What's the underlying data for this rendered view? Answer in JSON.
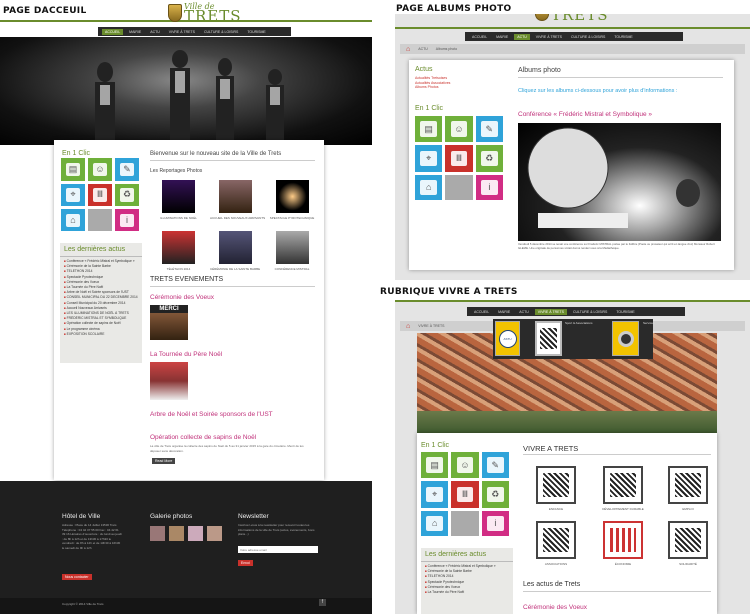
{
  "captions": {
    "home": "PAGE DACCEUIL",
    "albums": "PAGE ALBUMS PHOTO",
    "vivre": "RUBRIQUE VIVRE A TRETS"
  },
  "logo": {
    "line1": "Ville de",
    "line2": "TRETS"
  },
  "nav": [
    "ACCUEIL",
    "MAIRIE",
    "ACTU",
    "VIVRE À TRETS",
    "CULTURE & LOISIRS",
    "TOURISME"
  ],
  "home": {
    "en1clic": "En 1 Clic",
    "welcome": "Bienvenue sur le nouveau site de la Ville de Trets",
    "reportages": "Les Reportages Photos",
    "thumbs": [
      "ILLUMINATIONS DE NOËL",
      "ACCUEIL DES NOUVEAUX ARRIVANTS",
      "SPECTACLE PYROTECHNIQUE",
      "TÉLÉTHON 2014",
      "CÉRÉMONIE DE LA SAINTE BARBE",
      "CONFÉRENCE MISTRAL"
    ],
    "events": "TRETS EVENEMENTS",
    "ev1": "Cérémonie des Voeux",
    "ev2": "La Tournée du Père Noël",
    "ev3": "Arbre de Noël et Soirée sponsors de l'UST",
    "ev4": "Opération collecte de sapins de Noël",
    "ev4_text": "La ville de Trets organise la collecte des sapins de Noël du 5 au 31 janvier 2015 à la gare du cimetière. Merci de les déposer sans décoration.",
    "read_more": "Read More",
    "news_title": "Les dernières actus",
    "news": [
      "Conférence « Frédéric Mistral et Symbolique »",
      "Cérémonie de la Sainte Barbe",
      "TELETHON 2014",
      "Spectacle Pyrotechnique",
      "Cérémonie des Voeux",
      "La Tournée du Père Noël",
      "Arbre de Noël et Soirée sponsors de l'UST",
      "CONSEIL MUNICIPAL DU 22 DECEMBRE 2014",
      "Conseil Municipal du 20 décembre 2014",
      "Accueil Nouveaux Arrivants",
      "LES ILLUMINATIONS DE NOËL À TRETS",
      "FRÉDÉRIC MISTRAL ET SYMBOLIQUE",
      "Opération collecte de sapins de Noël",
      "Le programme cinéma",
      "EXPOSITION SCOLAIRE"
    ],
    "merci": "MERCI",
    "footer": {
      "hotel": "Hôtel de Ville",
      "addr": "Adresse : Place du 14 Juillet 13530 Trets Téléphone : 04 42 37 55 00 Fax : 04 42 61 39 16 Horaires d'ouverture : du lundi au jeudi : de 8h à 12h et de 13h30 à 17h30 le vendredi : de 8h à 12h et de 13h30 à 16h30 le samedi de 9h à 12h",
      "contact": "Nous contacter",
      "galerie": "Galerie photos",
      "newsletter": "Newsletter",
      "nl_text": "Inscrivez-vous à la newsletter pour recevoir toutes les informations de la ville de Trets (actus, évènements, bons plans...)",
      "nl_placeholder": "Votre adresse email",
      "nl_btn": "Envoi",
      "copyright": "Copyright © 2014 Ville de Trets",
      "fb": "f"
    }
  },
  "albums": {
    "breadcrumb": [
      "ACTU",
      "Albums photo"
    ],
    "actus": "Actus",
    "side_links": [
      "Actualités Tretsoises",
      "Actualités Associatives",
      "Albums Photos"
    ],
    "en1clic": "En 1 Clic",
    "title": "Albums photo",
    "intro": "Cliquez sur les albums ci-dessous pour avoir plus d'informations :",
    "conf": "Conférence « Frédéric Mistral et Symbolique »",
    "caption": "Vendredi 5 décembre 2014 se tenait une conférence sur Frédéric MISTRAL portée par le Félibre (Poète ou prosateur qui écrit en langue d'oc) Monsieur Robert GLEIZE. Une originale de personnes s'était donné rendez-vous à la Médiathèque."
  },
  "vivre": {
    "breadcrumb": "VIVRE À TRETS",
    "sub_label": "Sport & Associations",
    "sub_label2": "Services",
    "en1clic": "En 1 Clic",
    "title": "VIVRE A TRETS",
    "icons": [
      "ENFANCE",
      "DÉVELOPPEMENT DURABLE",
      "EMPLOI",
      "ASSOCIATIONS",
      "ÉCONOMIE",
      "SOLIDARITÉ"
    ],
    "news_title": "Les dernières actus",
    "news": [
      "Conférence « Frédéric Mistral et Symbolique »",
      "Cérémonie de la Sainte Barbe",
      "TELETHON 2014",
      "Spectacle Pyrotechnique",
      "Cérémonie des Voeux",
      "La Tournée du Père Noël"
    ],
    "actus_title": "Les actus de Trets",
    "actus_first": "Cérémonie des Voeux"
  }
}
